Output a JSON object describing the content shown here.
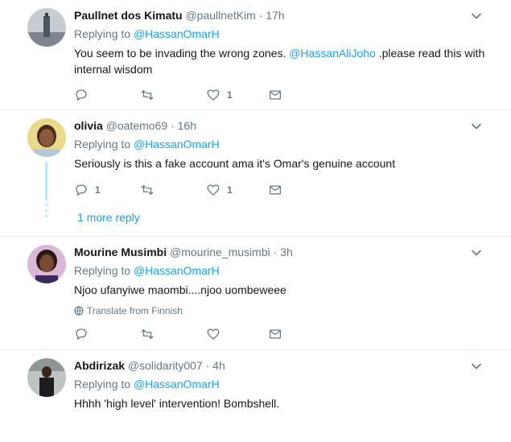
{
  "tweets": [
    {
      "display_name": "Paullnet dos Kimatu",
      "handle": "@paullnetKim",
      "dot": "·",
      "time": "17h",
      "replying_prefix": "Replying to",
      "replying_to": "@HassanOmarH",
      "text_before": "You seem to be invading the wrong zones.",
      "text_mention": "@HassanAliJoho",
      "text_after": ".please read this with internal wisdom",
      "reply_count": "",
      "retweet_count": "",
      "like_count": "1"
    },
    {
      "display_name": "olivia",
      "handle": "@oatemo69",
      "dot": "·",
      "time": "16h",
      "replying_prefix": "Replying to",
      "replying_to": "@HassanOmarH",
      "text": "Seriously is this a fake account ama it's Omar's genuine account",
      "reply_count": "1",
      "retweet_count": "",
      "like_count": "1",
      "more_replies": "1 more reply"
    },
    {
      "display_name": "Mourine Musimbi",
      "handle": "@mourine_musimbi",
      "dot": "·",
      "time": "3h",
      "replying_prefix": "Replying to",
      "replying_to": "@HassanOmarH",
      "text": "Njoo ufanyiwe maombi....njoo uombeweee",
      "translate": "Translate from Finnish",
      "reply_count": "",
      "retweet_count": "",
      "like_count": ""
    },
    {
      "display_name": "Abdirizak",
      "handle": "@solidarity007",
      "dot": "·",
      "time": "4h",
      "replying_prefix": "Replying to",
      "replying_to": "@HassanOmarH",
      "text": "Hhhh 'high level' intervention! Bombshell."
    }
  ],
  "colors": {
    "link": "#1da1f2",
    "secondary_text": "#657786",
    "primary_text": "#14171a",
    "divider": "#e6ecf0",
    "thread_line": "#bfe5fb"
  },
  "icons": {
    "reply": "reply-icon",
    "retweet": "retweet-icon",
    "like": "heart-icon",
    "dm": "envelope-icon",
    "more": "chevron-down-icon",
    "translate": "globe-icon"
  }
}
